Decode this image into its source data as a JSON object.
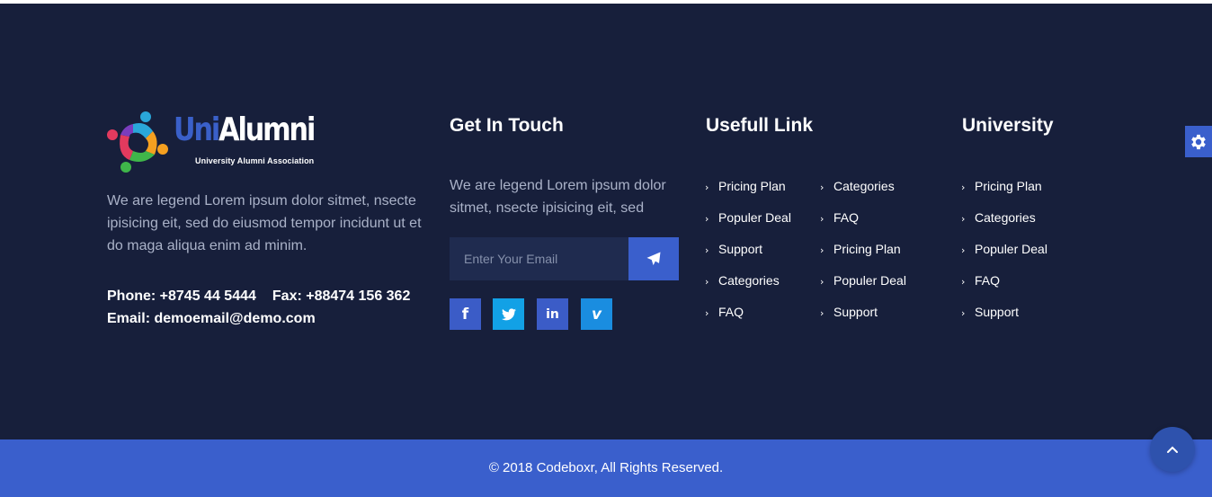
{
  "brand": {
    "title_part1": "Uni",
    "title_part2": "Alumni",
    "tagline": "University Alumni Association",
    "colors": {
      "uni": "#3a60c9",
      "footer_bg": "#171f3b",
      "accent": "#3a5fcc"
    }
  },
  "about": {
    "text": "We are legend Lorem ipsum dolor sitmet, nsecte ipisicing eit, sed do eiusmod tempor incidunt ut et do maga aliqua enim ad minim.",
    "phone": "Phone: +8745 44 5444",
    "fax": "Fax: +88474 156 362",
    "email": "Email: demoemail@demo.com"
  },
  "get_in_touch": {
    "title": "Get In Touch",
    "text": "We are legend Lorem ipsum dolor sitmet, nsecte ipisicing eit, sed",
    "email_placeholder": "Enter Your Email",
    "send_icon": "paper-plane-icon",
    "socials": [
      {
        "name": "facebook",
        "glyph": "f",
        "color": "#3b5cc7"
      },
      {
        "name": "twitter",
        "glyph": "t",
        "color": "#12a1e6"
      },
      {
        "name": "linkedin",
        "glyph": "in",
        "color": "#3b5cc7"
      },
      {
        "name": "vimeo",
        "glyph": "v",
        "color": "#1a8de0"
      }
    ]
  },
  "useful_links": {
    "title": "Usefull Link",
    "col1": [
      "Pricing Plan",
      "Populer Deal",
      "Support",
      "Categories",
      "FAQ"
    ],
    "col2": [
      "Categories",
      "FAQ",
      "Pricing Plan",
      "Populer Deal",
      "Support"
    ]
  },
  "university": {
    "title": "University",
    "links": [
      "Pricing Plan",
      "Categories",
      "Populer Deal",
      "FAQ",
      "Support"
    ]
  },
  "settings_icon": "gear-icon",
  "footer": {
    "copyright": "© 2018 Codeboxr, All Rights Reserved.",
    "back_to_top_icon": "chevron-up-icon"
  }
}
